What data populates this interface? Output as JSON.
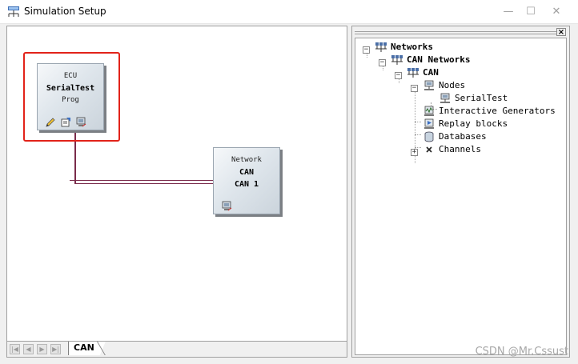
{
  "window": {
    "title": "Simulation Setup",
    "minimize_glyph": "—",
    "maximize_glyph": "☐",
    "close_glyph": "✕"
  },
  "canvas": {
    "ecu_block": {
      "kind": "ECU",
      "name": "SerialTest",
      "sub": "Prog",
      "selected": true
    },
    "network_block": {
      "kind": "Network",
      "name": "CAN",
      "sub": "CAN 1"
    },
    "tabs": [
      {
        "label": "CAN",
        "active": true
      }
    ],
    "nav_buttons": [
      "|◀",
      "◀",
      "▶",
      "▶|"
    ]
  },
  "tree": {
    "close_glyph": "×",
    "nodes": [
      {
        "label": "Networks",
        "bold": true,
        "icon": "network-icon",
        "expander": "−"
      },
      {
        "label": "CAN Networks",
        "bold": true,
        "icon": "network-icon",
        "expander": "−"
      },
      {
        "label": "CAN",
        "bold": true,
        "icon": "network-icon",
        "expander": "−"
      },
      {
        "label": "Nodes",
        "bold": false,
        "icon": "node-icon",
        "expander": "−"
      },
      {
        "label": "SerialTest",
        "bold": false,
        "icon": "node-icon",
        "expander": ""
      },
      {
        "label": "Interactive Generators",
        "bold": false,
        "icon": "generator-icon",
        "expander": ""
      },
      {
        "label": "Replay blocks",
        "bold": false,
        "icon": "replay-icon",
        "expander": ""
      },
      {
        "label": "Databases",
        "bold": false,
        "icon": "database-icon",
        "expander": ""
      },
      {
        "label": "Channels",
        "bold": false,
        "icon": "channels-icon",
        "expander": "+"
      }
    ]
  },
  "watermark": "CSDN @Mr.Cssust",
  "colors": {
    "selection": "#e2231a",
    "wire": "#7a2b4b"
  }
}
